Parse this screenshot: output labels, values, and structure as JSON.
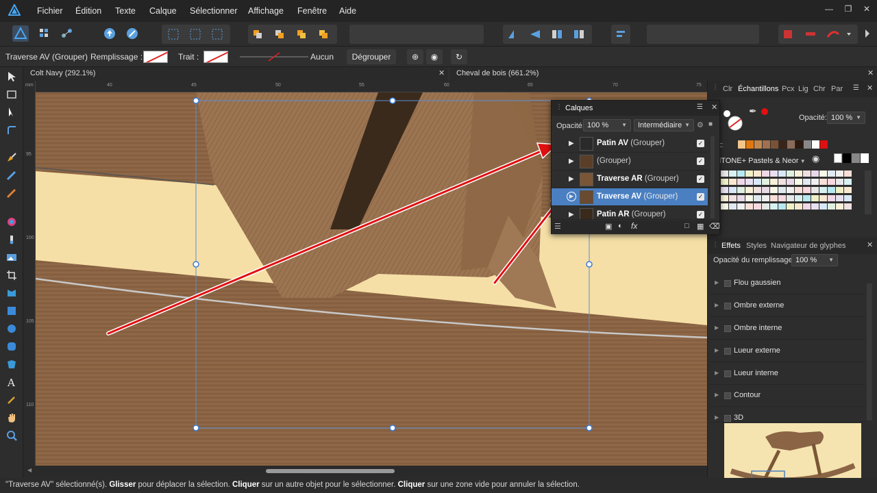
{
  "menu": [
    "Fichier",
    "Édition",
    "Texte",
    "Calque",
    "Sélectionner",
    "Affichage",
    "Fenêtre",
    "Aide"
  ],
  "context": {
    "selection": "Traverse AV (Grouper)",
    "fill_label": "Remplissage :",
    "stroke_label": "Trait :",
    "stroke_value": "Aucun",
    "ungroup_button": "Dégrouper"
  },
  "doc_tabs": [
    {
      "title": "Colt Navy (292.1%)"
    },
    {
      "title": "Cheval de bois (661.2%)"
    }
  ],
  "ruler": {
    "unit": "mm",
    "h_ticks": [
      "40",
      "45",
      "50",
      "55",
      "60",
      "65",
      "70",
      "75"
    ],
    "v_ticks": [
      "95",
      "100",
      "105",
      "110"
    ]
  },
  "right_panel": {
    "tabs_top": [
      "Clr",
      "Échantillons",
      "Pcx",
      "Lig",
      "Chr",
      "Par"
    ],
    "opacity_label": "Opacité:",
    "opacity_value": "100 %",
    "recent_label": "ent:",
    "palette_name": "ANTONE+ Pastels & Neor",
    "tabs_bottom": [
      "Effets",
      "Styles",
      "Navigateur de glyphes"
    ],
    "fill_opacity_label": "Opacité du remplissage:",
    "fill_opacity_value": "100 %",
    "effects": [
      "Flou gaussien",
      "Ombre externe",
      "Ombre interne",
      "Lueur externe",
      "Lueur interne",
      "Contour",
      "3D"
    ]
  },
  "layers": {
    "title": "Calques",
    "opacity_label": "Opacité:",
    "opacity_value": "100 %",
    "blend_mode": "Intermédiaire",
    "items": [
      {
        "name": "Patin AV",
        "type": "(Grouper)",
        "selected": false
      },
      {
        "name": "",
        "type": "(Grouper)",
        "selected": false
      },
      {
        "name": "Traverse AR",
        "type": "(Grouper)",
        "selected": false
      },
      {
        "name": "Traverse AV",
        "type": "(Grouper)",
        "selected": true
      },
      {
        "name": "Patin AR",
        "type": "(Grouper)",
        "selected": false
      }
    ]
  },
  "status": {
    "part1": "\"Traverse AV\" sélectionné(s). ",
    "b1": "Glisser",
    "part2": " pour déplacer la sélection. ",
    "b2": "Cliquer",
    "part3": " sur un autre objet pour le sélectionner. ",
    "b3": "Cliquer",
    "part4": " sur une zone vide pour annuler la sélection."
  },
  "colors": {
    "accent": "#4a7fc1",
    "wood": "#8b6443",
    "cream": "#f5e0a8",
    "arrow_red": "#e01010"
  }
}
